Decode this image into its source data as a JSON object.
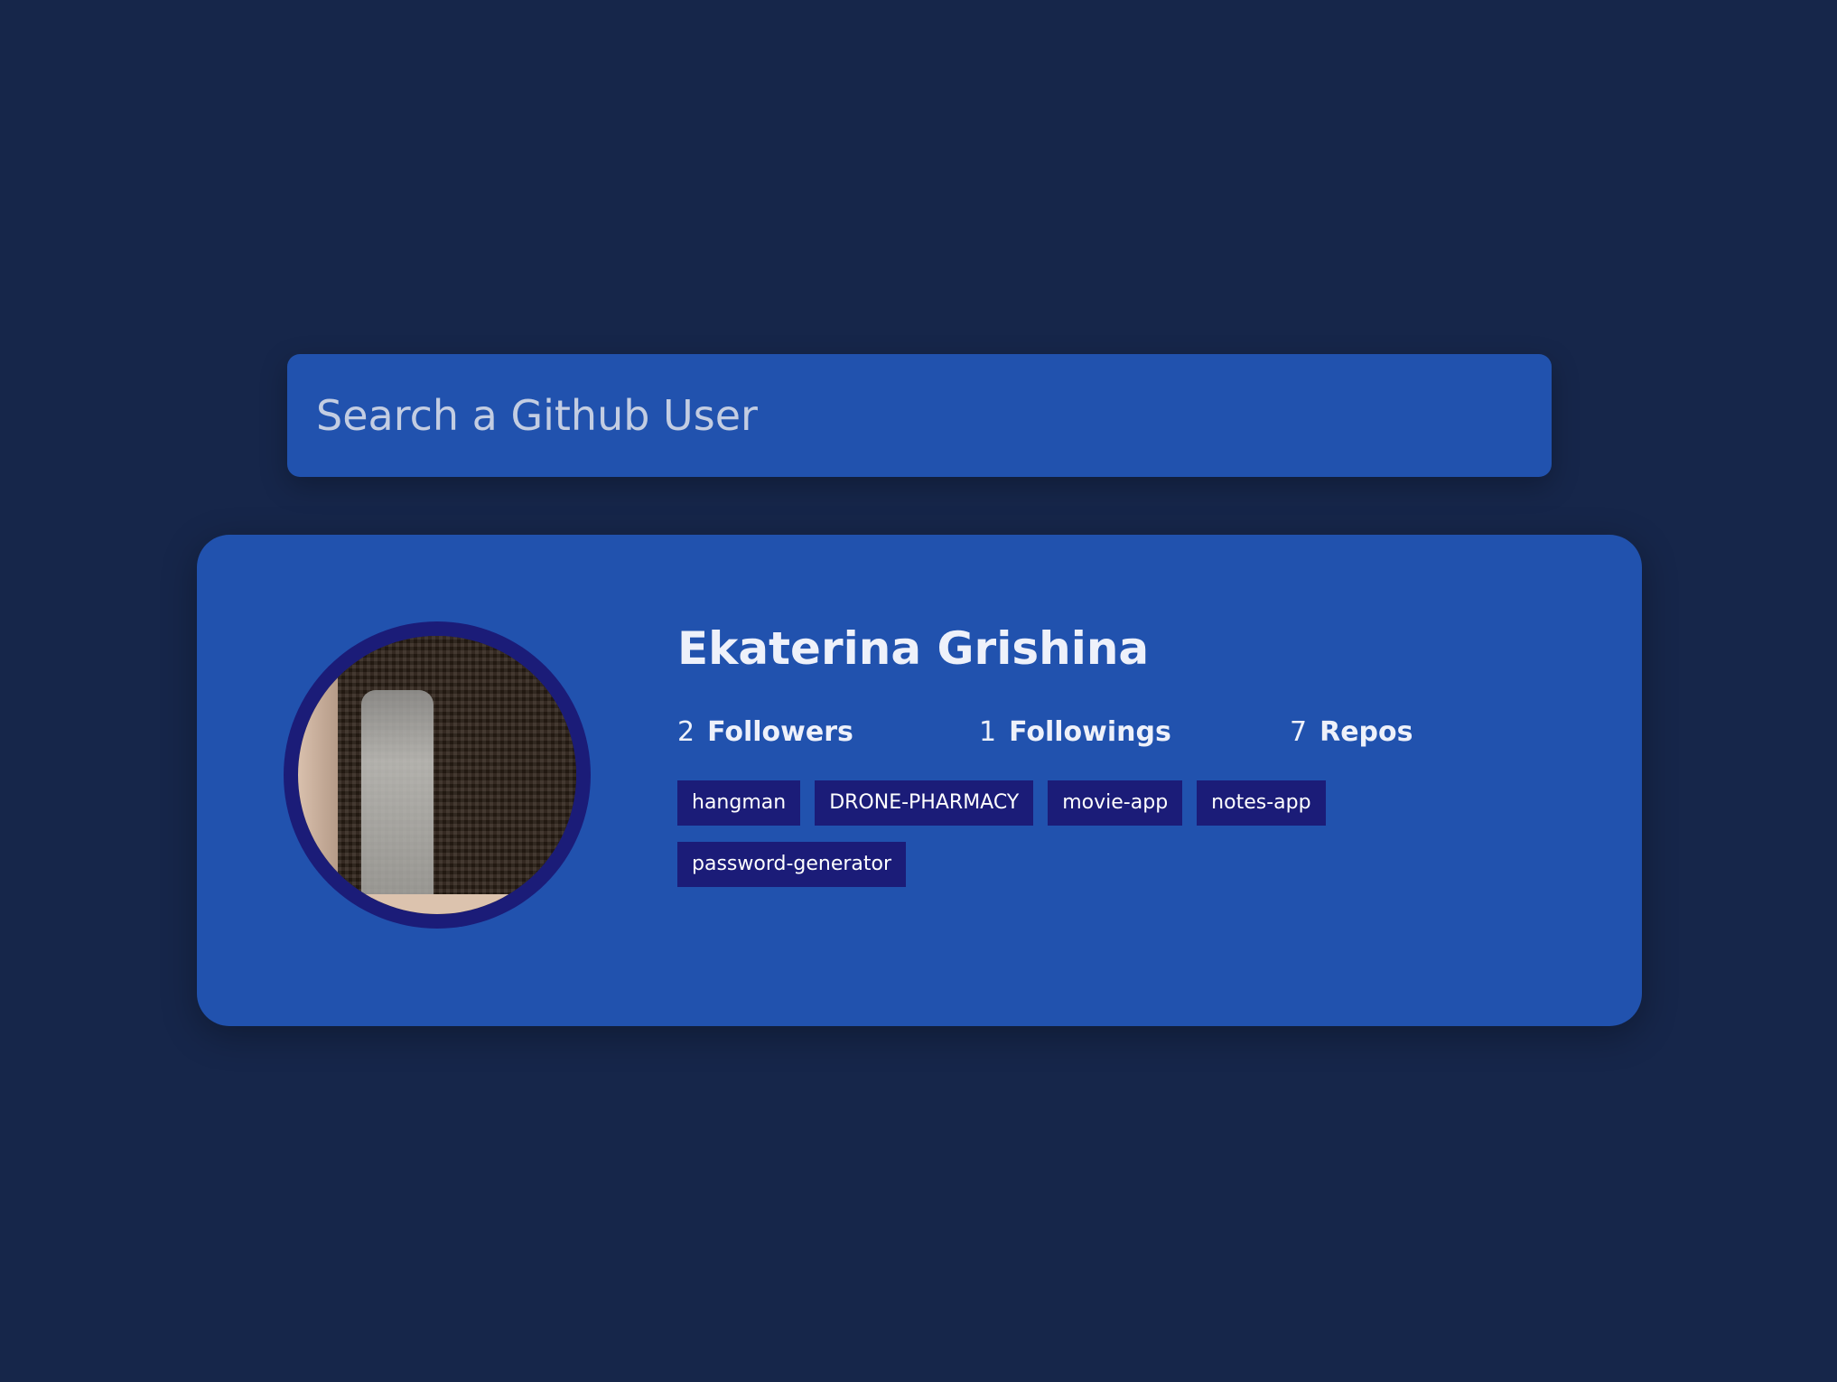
{
  "search": {
    "placeholder": "Search a Github User"
  },
  "user": {
    "name": "Ekaterina Grishina",
    "avatar_icon": "user-avatar-image"
  },
  "stats": [
    {
      "value": "2",
      "label": "Followers"
    },
    {
      "value": "1",
      "label": "Followings"
    },
    {
      "value": "7",
      "label": "Repos"
    }
  ],
  "repos": [
    {
      "name": "hangman"
    },
    {
      "name": "DRONE-PHARMACY"
    },
    {
      "name": "movie-app"
    },
    {
      "name": "notes-app"
    },
    {
      "name": "password-generator"
    }
  ],
  "colors": {
    "background": "#16264a",
    "card": "#2152ae",
    "repo_tag": "#1b1c78",
    "avatar_border": "#1b1c78"
  }
}
